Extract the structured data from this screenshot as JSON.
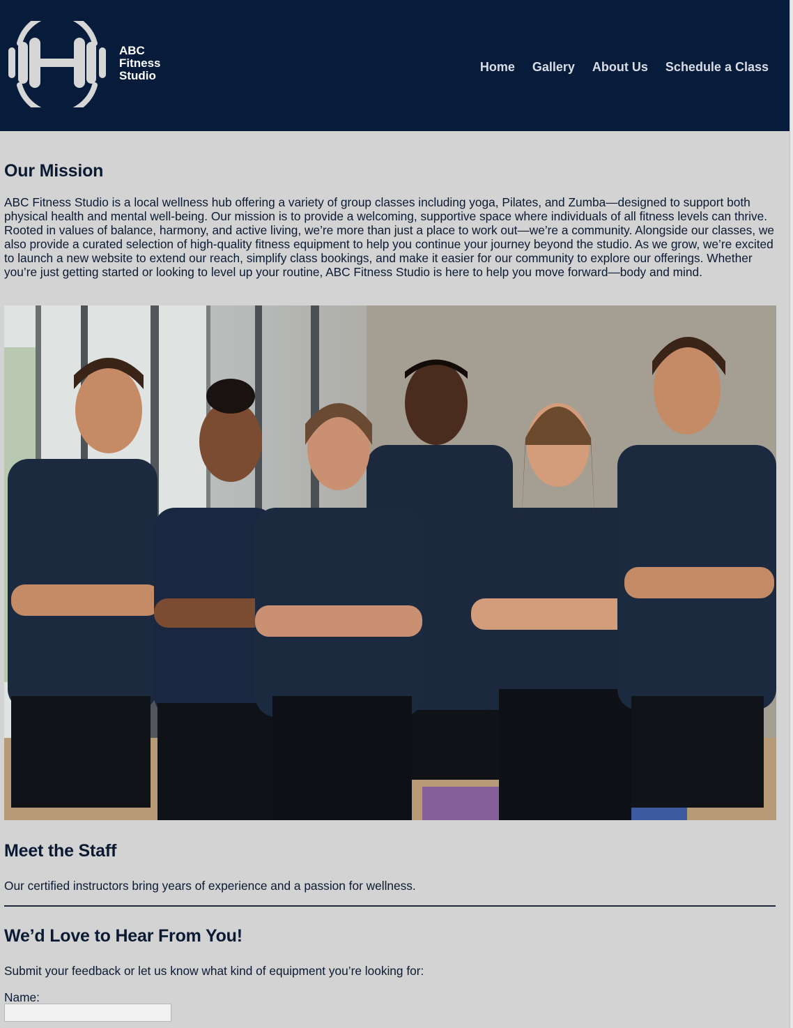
{
  "brand": {
    "line1": "ABC",
    "line2": "Fitness",
    "line3": "Studio",
    "logo_icon": "dumbbell-icon"
  },
  "nav": {
    "items": [
      {
        "label": "Home"
      },
      {
        "label": "Gallery"
      },
      {
        "label": "About Us"
      },
      {
        "label": "Schedule a Class"
      }
    ]
  },
  "mission": {
    "title": "Our Mission",
    "text": "ABC Fitness Studio is a local wellness hub offering a variety of group classes including yoga, Pilates, and Zumba—designed to support both physical health and mental well-being. Our mission is to provide a welcoming, supportive space where individuals of all fitness levels can thrive. Rooted in values of balance, harmony, and active living, we’re more than just a place to work out—we’re a community. Alongside our classes, we also provide a curated selection of high-quality fitness equipment to help you continue your journey beyond the studio. As we grow, we’re excited to launch a new website to extend our reach, simplify class bookings, and make it easier for our community to explore our offerings. Whether you’re just getting started or looking to level up your routine, ABC Fitness Studio is here to help you move forward—body and mind."
  },
  "staff": {
    "title": "Meet the Staff",
    "text": "Our certified instructors bring years of experience and a passion for wellness."
  },
  "contact": {
    "title": "We’d Love to Hear From You!",
    "text": "Submit your feedback or let us know what kind of equipment you’re looking for:",
    "name_label": "Name:",
    "name_value": ""
  },
  "colors": {
    "header_bg": "#071b3b",
    "page_bg": "#d3d3d3",
    "heading": "#0b1a33",
    "shirt": "#1c2a40"
  }
}
